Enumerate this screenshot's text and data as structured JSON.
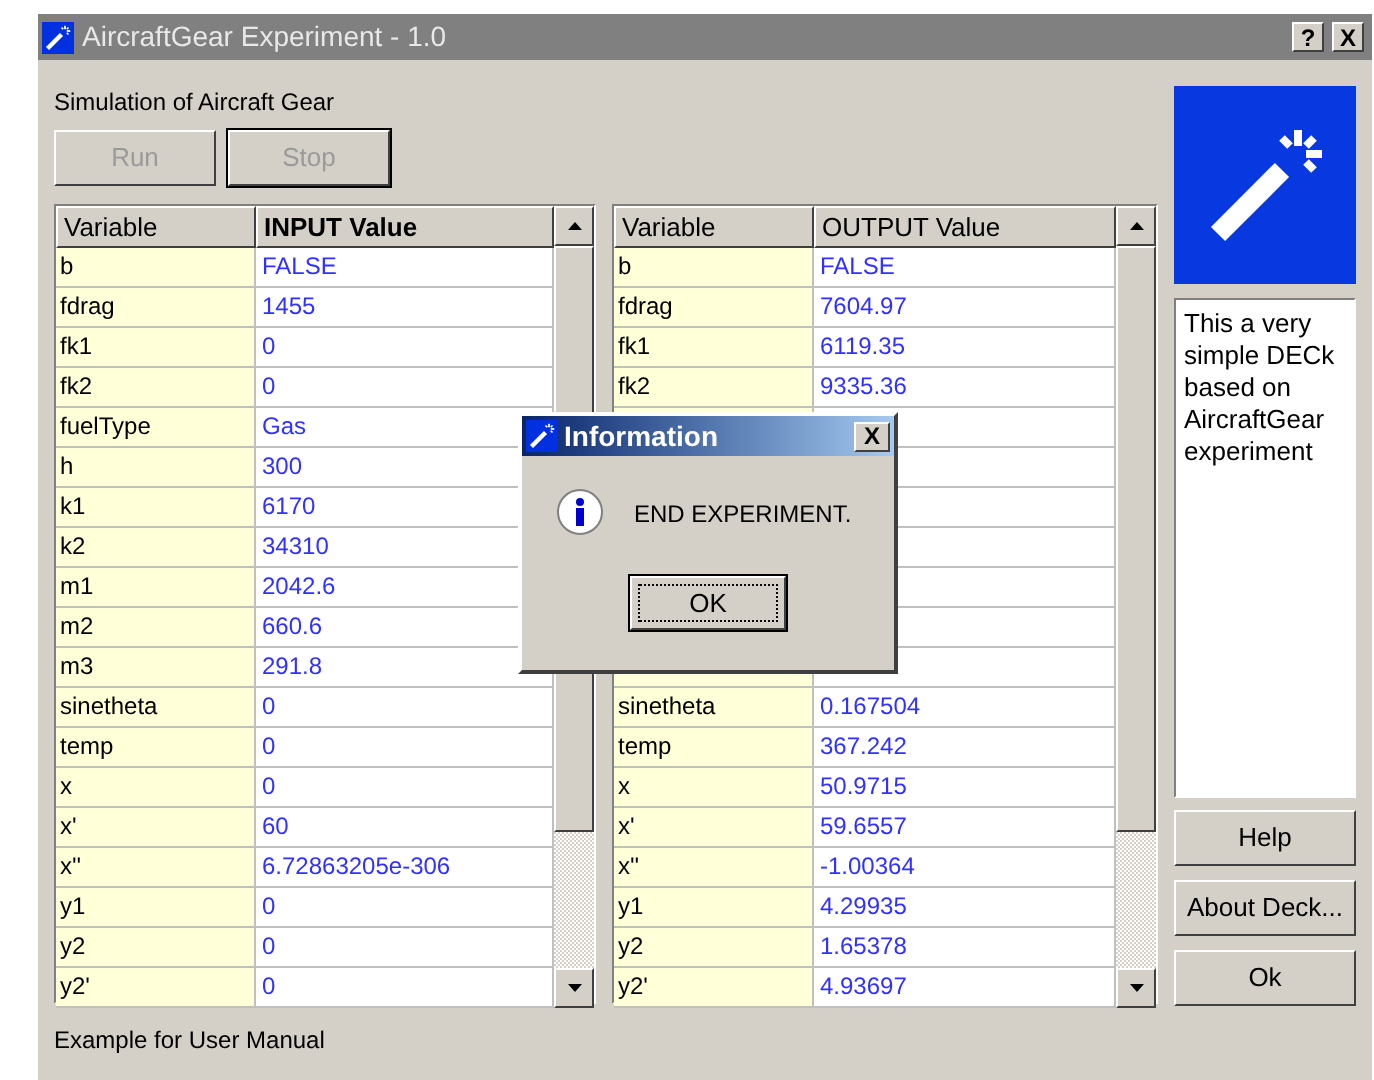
{
  "window": {
    "title": "AircraftGear Experiment - 1.0",
    "help_button": "?",
    "close_button": "X"
  },
  "subtitle": "Simulation of Aircraft Gear",
  "buttons": [
    {
      "label": "Run",
      "disabled": true,
      "default": false
    },
    {
      "label": "Stop",
      "disabled": true,
      "default": true
    }
  ],
  "input_table": {
    "columns": [
      {
        "label": "Variable",
        "bold": false
      },
      {
        "label": "INPUT Value",
        "bold": true
      }
    ],
    "rows": [
      {
        "variable": "b",
        "value": "FALSE"
      },
      {
        "variable": "fdrag",
        "value": "1455"
      },
      {
        "variable": "fk1",
        "value": "0"
      },
      {
        "variable": "fk2",
        "value": "0"
      },
      {
        "variable": "fuelType",
        "value": "Gas"
      },
      {
        "variable": "h",
        "value": "300"
      },
      {
        "variable": "k1",
        "value": "6170"
      },
      {
        "variable": "k2",
        "value": "34310"
      },
      {
        "variable": "m1",
        "value": "2042.6"
      },
      {
        "variable": "m2",
        "value": "660.6"
      },
      {
        "variable": "m3",
        "value": "291.8"
      },
      {
        "variable": "sinetheta",
        "value": "0"
      },
      {
        "variable": "temp",
        "value": "0"
      },
      {
        "variable": "x",
        "value": "0"
      },
      {
        "variable": "x'",
        "value": "60"
      },
      {
        "variable": "x''",
        "value": "6.72863205e-306"
      },
      {
        "variable": "y1",
        "value": "0"
      },
      {
        "variable": "y2",
        "value": "0"
      },
      {
        "variable": "y2'",
        "value": "0"
      }
    ]
  },
  "output_table": {
    "columns": [
      {
        "label": "Variable",
        "bold": false
      },
      {
        "label": "OUTPUT Value",
        "bold": false
      }
    ],
    "rows_above": [
      {
        "variable": "b",
        "value": "FALSE"
      },
      {
        "variable": "fdrag",
        "value": "7604.97"
      },
      {
        "variable": "fk1",
        "value": "6119.35"
      },
      {
        "variable": "fk2",
        "value": "9335.36"
      }
    ],
    "rows_below": [
      {
        "variable": "sinetheta",
        "value": "0.167504"
      },
      {
        "variable": "temp",
        "value": "367.242"
      },
      {
        "variable": "x",
        "value": "50.9715"
      },
      {
        "variable": "x'",
        "value": "59.6557"
      },
      {
        "variable": "x''",
        "value": "-1.00364"
      },
      {
        "variable": "y1",
        "value": "4.29935"
      },
      {
        "variable": "y2",
        "value": "1.65378"
      },
      {
        "variable": "y2'",
        "value": "4.93697"
      }
    ]
  },
  "description": "This a very simple DECk based on AircraftGear experiment",
  "side_buttons": [
    "Help",
    "About Deck...",
    "Ok"
  ],
  "footer": "Example for User Manual",
  "dialog": {
    "title": "Information",
    "close_button": "X",
    "message": "END EXPERIMENT.",
    "button": "OK"
  }
}
